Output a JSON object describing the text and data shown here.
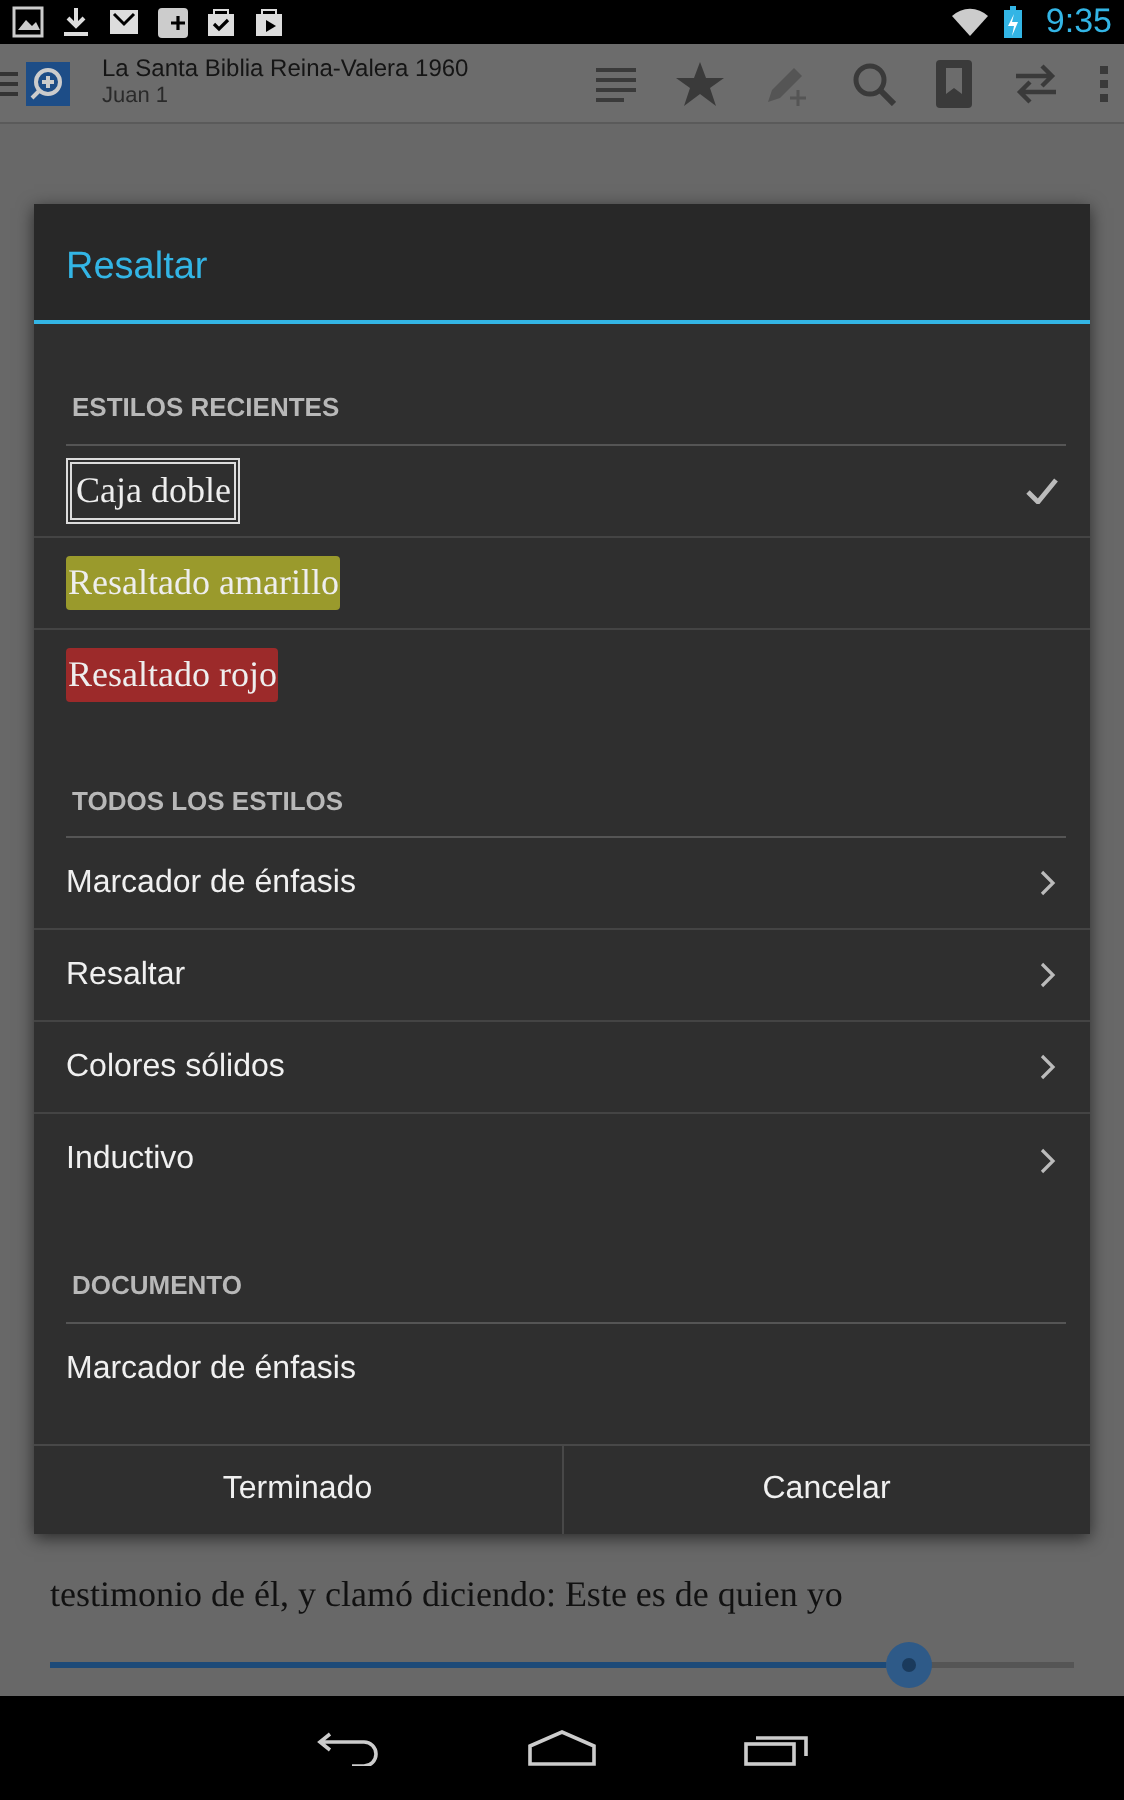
{
  "status_bar": {
    "time": "9:35"
  },
  "app_bar": {
    "title": "La Santa Biblia Reina-Valera 1960",
    "subtitle": "Juan 1"
  },
  "reader": {
    "text": "testimonio de él, y clamó diciendo: Este es de quien yo",
    "slider": {
      "level": 0.84
    }
  },
  "dialog": {
    "title": "Resaltar",
    "sections": [
      {
        "heading": "ESTILOS RECIENTES",
        "items": [
          {
            "label": "Caja doble",
            "kind": "box",
            "selected": true
          },
          {
            "label": "Resaltado amarillo",
            "kind": "highlight",
            "color": "#9a9a2c",
            "selected": false
          },
          {
            "label": "Resaltado rojo",
            "kind": "highlight",
            "color": "#9c2a2a",
            "selected": false
          }
        ]
      },
      {
        "heading": "TODOS LOS ESTILOS",
        "items": [
          {
            "label": "Marcador de énfasis",
            "kind": "submenu"
          },
          {
            "label": "Resaltar",
            "kind": "submenu"
          },
          {
            "label": "Colores sólidos",
            "kind": "submenu"
          },
          {
            "label": "Inductivo",
            "kind": "submenu"
          }
        ]
      },
      {
        "heading": "DOCUMENTO",
        "items": [
          {
            "label": "Marcador de énfasis",
            "kind": "plain"
          }
        ]
      }
    ],
    "buttons": [
      "Terminado",
      "Cancelar"
    ]
  }
}
